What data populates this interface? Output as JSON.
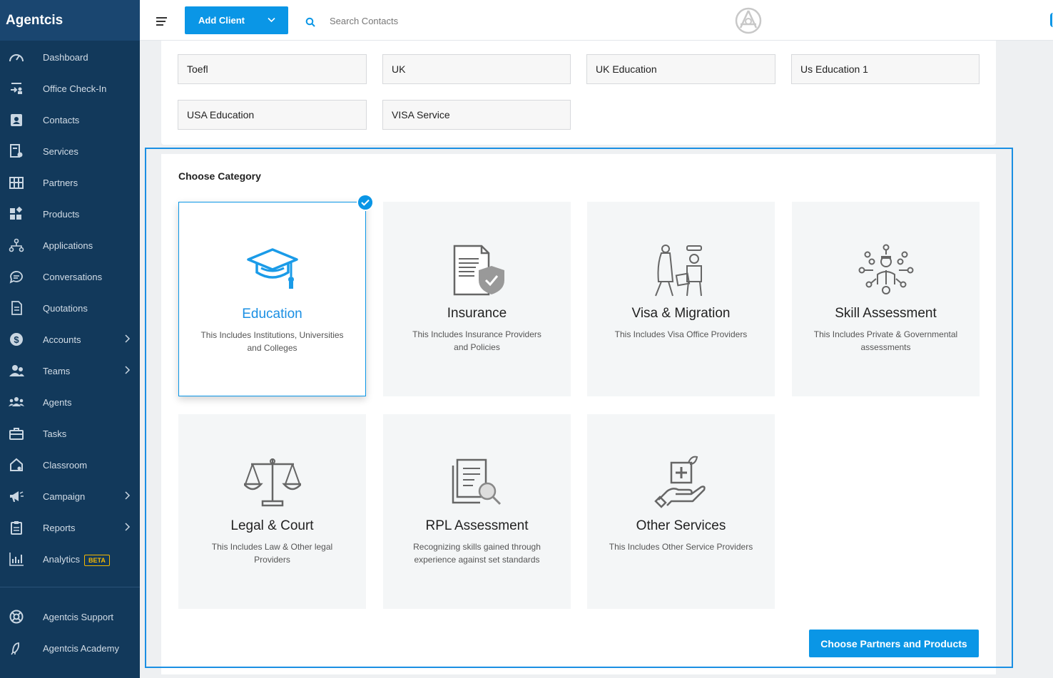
{
  "brand": {
    "name": "Agentcis"
  },
  "sidebar": {
    "items": [
      {
        "label": "Dashboard",
        "icon": "dashboard-icon"
      },
      {
        "label": "Office Check-In",
        "icon": "check-in-icon"
      },
      {
        "label": "Contacts",
        "icon": "contacts-icon"
      },
      {
        "label": "Services",
        "icon": "services-icon"
      },
      {
        "label": "Partners",
        "icon": "partners-icon"
      },
      {
        "label": "Products",
        "icon": "products-icon"
      },
      {
        "label": "Applications",
        "icon": "applications-icon"
      },
      {
        "label": "Conversations",
        "icon": "conversations-icon"
      },
      {
        "label": "Quotations",
        "icon": "quotations-icon"
      },
      {
        "label": "Accounts",
        "icon": "accounts-icon",
        "expandable": true
      },
      {
        "label": "Teams",
        "icon": "teams-icon",
        "expandable": true
      },
      {
        "label": "Agents",
        "icon": "agents-icon"
      },
      {
        "label": "Tasks",
        "icon": "tasks-icon"
      },
      {
        "label": "Classroom",
        "icon": "classroom-icon"
      },
      {
        "label": "Campaign",
        "icon": "campaign-icon",
        "expandable": true
      },
      {
        "label": "Reports",
        "icon": "reports-icon",
        "expandable": true
      },
      {
        "label": "Analytics",
        "icon": "analytics-icon",
        "badge": "BETA"
      }
    ],
    "support": [
      {
        "label": "Agentcis Support",
        "icon": "support-icon"
      },
      {
        "label": "Agentcis Academy",
        "icon": "academy-icon"
      }
    ]
  },
  "topbar": {
    "add_client_label": "Add Client",
    "search_placeholder": "Search Contacts"
  },
  "services": [
    "Toefl",
    "UK",
    "UK Education",
    "Us Education 1",
    "USA Education",
    "VISA Service"
  ],
  "category_section": {
    "title": "Choose Category",
    "cards": [
      {
        "title": "Education",
        "desc": "This Includes Institutions, Universities and Colleges",
        "selected": true,
        "icon": "graduation-cap-icon"
      },
      {
        "title": "Insurance",
        "desc": "This Includes Insurance Providers and Policies",
        "selected": false,
        "icon": "insurance-document-icon"
      },
      {
        "title": "Visa & Migration",
        "desc": "This Includes Visa Office Providers",
        "selected": false,
        "icon": "migration-icon"
      },
      {
        "title": "Skill Assessment",
        "desc": "This Includes Private & Governmental assessments",
        "selected": false,
        "icon": "skill-assessment-icon"
      },
      {
        "title": "Legal & Court",
        "desc": "This Includes Law & Other legal Providers",
        "selected": false,
        "icon": "scales-icon"
      },
      {
        "title": "RPL Assessment",
        "desc": "Recognizing skills gained through experience against set standards",
        "selected": false,
        "icon": "document-search-icon"
      },
      {
        "title": "Other Services",
        "desc": "This Includes Other Service Providers",
        "selected": false,
        "icon": "hand-care-icon"
      }
    ],
    "cta_label": "Choose Partners and Products"
  },
  "colors": {
    "accent": "#0a96e6",
    "sidebar": "#12395b"
  }
}
